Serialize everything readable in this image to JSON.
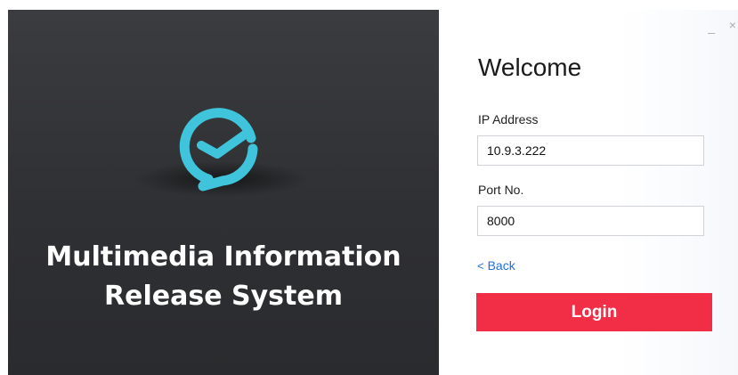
{
  "app": {
    "title_line1": "Multimedia Information",
    "title_line2": "Release System"
  },
  "window_controls": {
    "minimize_glyph": "_",
    "close_glyph": "×"
  },
  "form": {
    "welcome": "Welcome",
    "ip_label": "IP Address",
    "ip_value": "10.9.3.222",
    "port_label": "Port No.",
    "port_value": "8000",
    "back_chevron": "<",
    "back_label": "Back",
    "login_label": "Login"
  },
  "colors": {
    "accent": "#f22d46",
    "logo": "#3fc4dc",
    "link": "#1e6fd9",
    "left_panel": "#323336"
  },
  "icons": {
    "logo": "chat-bubble-clock-logo-icon",
    "back": "chevron-left-icon"
  }
}
